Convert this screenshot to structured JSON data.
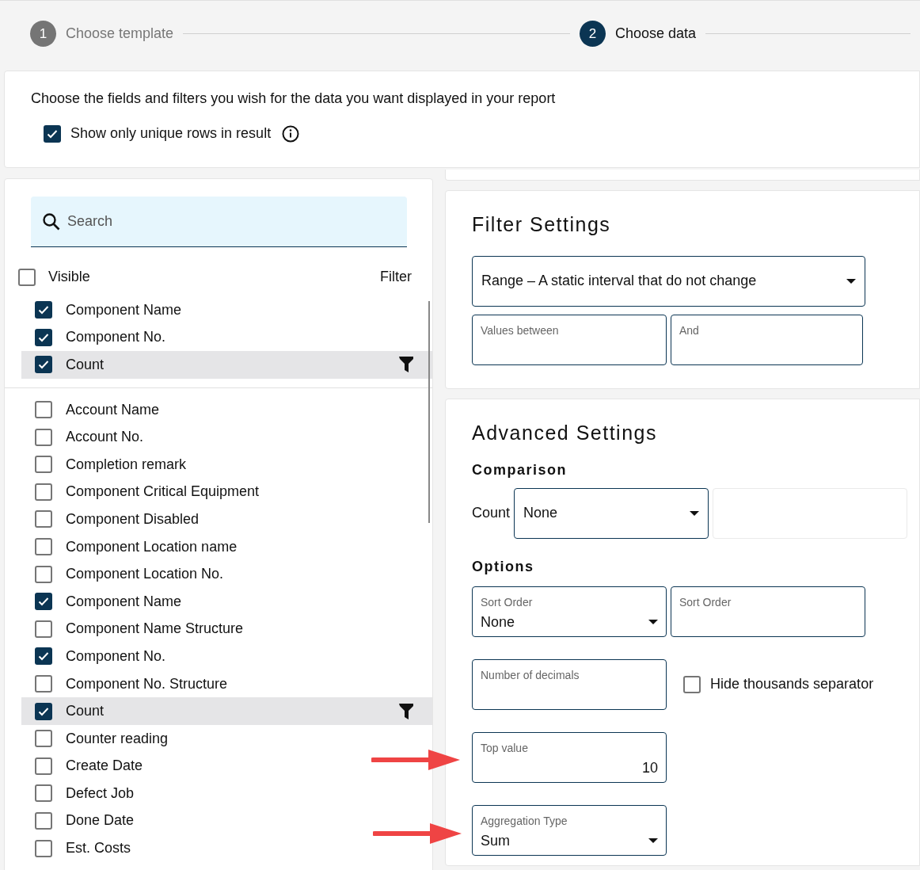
{
  "stepper": {
    "steps": [
      {
        "number": "1",
        "label": "Choose template",
        "selected": false
      },
      {
        "number": "2",
        "label": "Choose data",
        "selected": true
      }
    ]
  },
  "intro": {
    "text": "Choose the fields and filters you wish for the data you want displayed in your report",
    "unique_rows": {
      "label": "Show only unique rows in result",
      "checked": true
    }
  },
  "field_list": {
    "search": {
      "placeholder": "Search"
    },
    "header": {
      "visible_label": "Visible",
      "checked": false,
      "filter_label": "Filter"
    },
    "chosen": [
      {
        "label": "Component Name",
        "checked": true,
        "selected": false,
        "filtered": false
      },
      {
        "label": "Component No.",
        "checked": true,
        "selected": false,
        "filtered": false
      },
      {
        "label": "Count",
        "checked": true,
        "selected": true,
        "filtered": true
      }
    ],
    "all": [
      {
        "label": "Account Name",
        "checked": false,
        "selected": false,
        "filtered": false
      },
      {
        "label": "Account No.",
        "checked": false,
        "selected": false,
        "filtered": false
      },
      {
        "label": "Completion remark",
        "checked": false,
        "selected": false,
        "filtered": false
      },
      {
        "label": "Component Critical Equipment",
        "checked": false,
        "selected": false,
        "filtered": false
      },
      {
        "label": "Component Disabled",
        "checked": false,
        "selected": false,
        "filtered": false
      },
      {
        "label": "Component Location name",
        "checked": false,
        "selected": false,
        "filtered": false
      },
      {
        "label": "Component Location No.",
        "checked": false,
        "selected": false,
        "filtered": false
      },
      {
        "label": "Component Name",
        "checked": true,
        "selected": false,
        "filtered": false
      },
      {
        "label": "Component Name Structure",
        "checked": false,
        "selected": false,
        "filtered": false
      },
      {
        "label": "Component No.",
        "checked": true,
        "selected": false,
        "filtered": false
      },
      {
        "label": "Component No. Structure",
        "checked": false,
        "selected": false,
        "filtered": false
      },
      {
        "label": "Count",
        "checked": true,
        "selected": true,
        "filtered": true
      },
      {
        "label": "Counter reading",
        "checked": false,
        "selected": false,
        "filtered": false
      },
      {
        "label": "Create Date",
        "checked": false,
        "selected": false,
        "filtered": false
      },
      {
        "label": "Defect Job",
        "checked": false,
        "selected": false,
        "filtered": false
      },
      {
        "label": "Done Date",
        "checked": false,
        "selected": false,
        "filtered": false
      },
      {
        "label": "Est. Costs",
        "checked": false,
        "selected": false,
        "filtered": false
      }
    ]
  },
  "filter_settings": {
    "title": "Filter Settings",
    "range_select": {
      "value": "Range – A static interval that do not change"
    },
    "from_field": {
      "label": "Values between"
    },
    "to_field": {
      "label": "And"
    }
  },
  "advanced_settings": {
    "title": "Advanced Settings",
    "comparison": {
      "heading": "Comparison",
      "label": "Count",
      "operator": {
        "value": "None"
      }
    },
    "options": {
      "heading": "Options",
      "sort_order": {
        "label": "Sort Order",
        "value": "None"
      },
      "sort_order_field": {
        "label": "Sort Order"
      },
      "decimals": {
        "label": "Number of decimals"
      },
      "hide_thousands": {
        "label": "Hide thousands separator",
        "checked": false
      },
      "top_value": {
        "label": "Top value",
        "value": "10"
      },
      "aggregation": {
        "label": "Aggregation Type",
        "value": "Sum"
      }
    }
  }
}
